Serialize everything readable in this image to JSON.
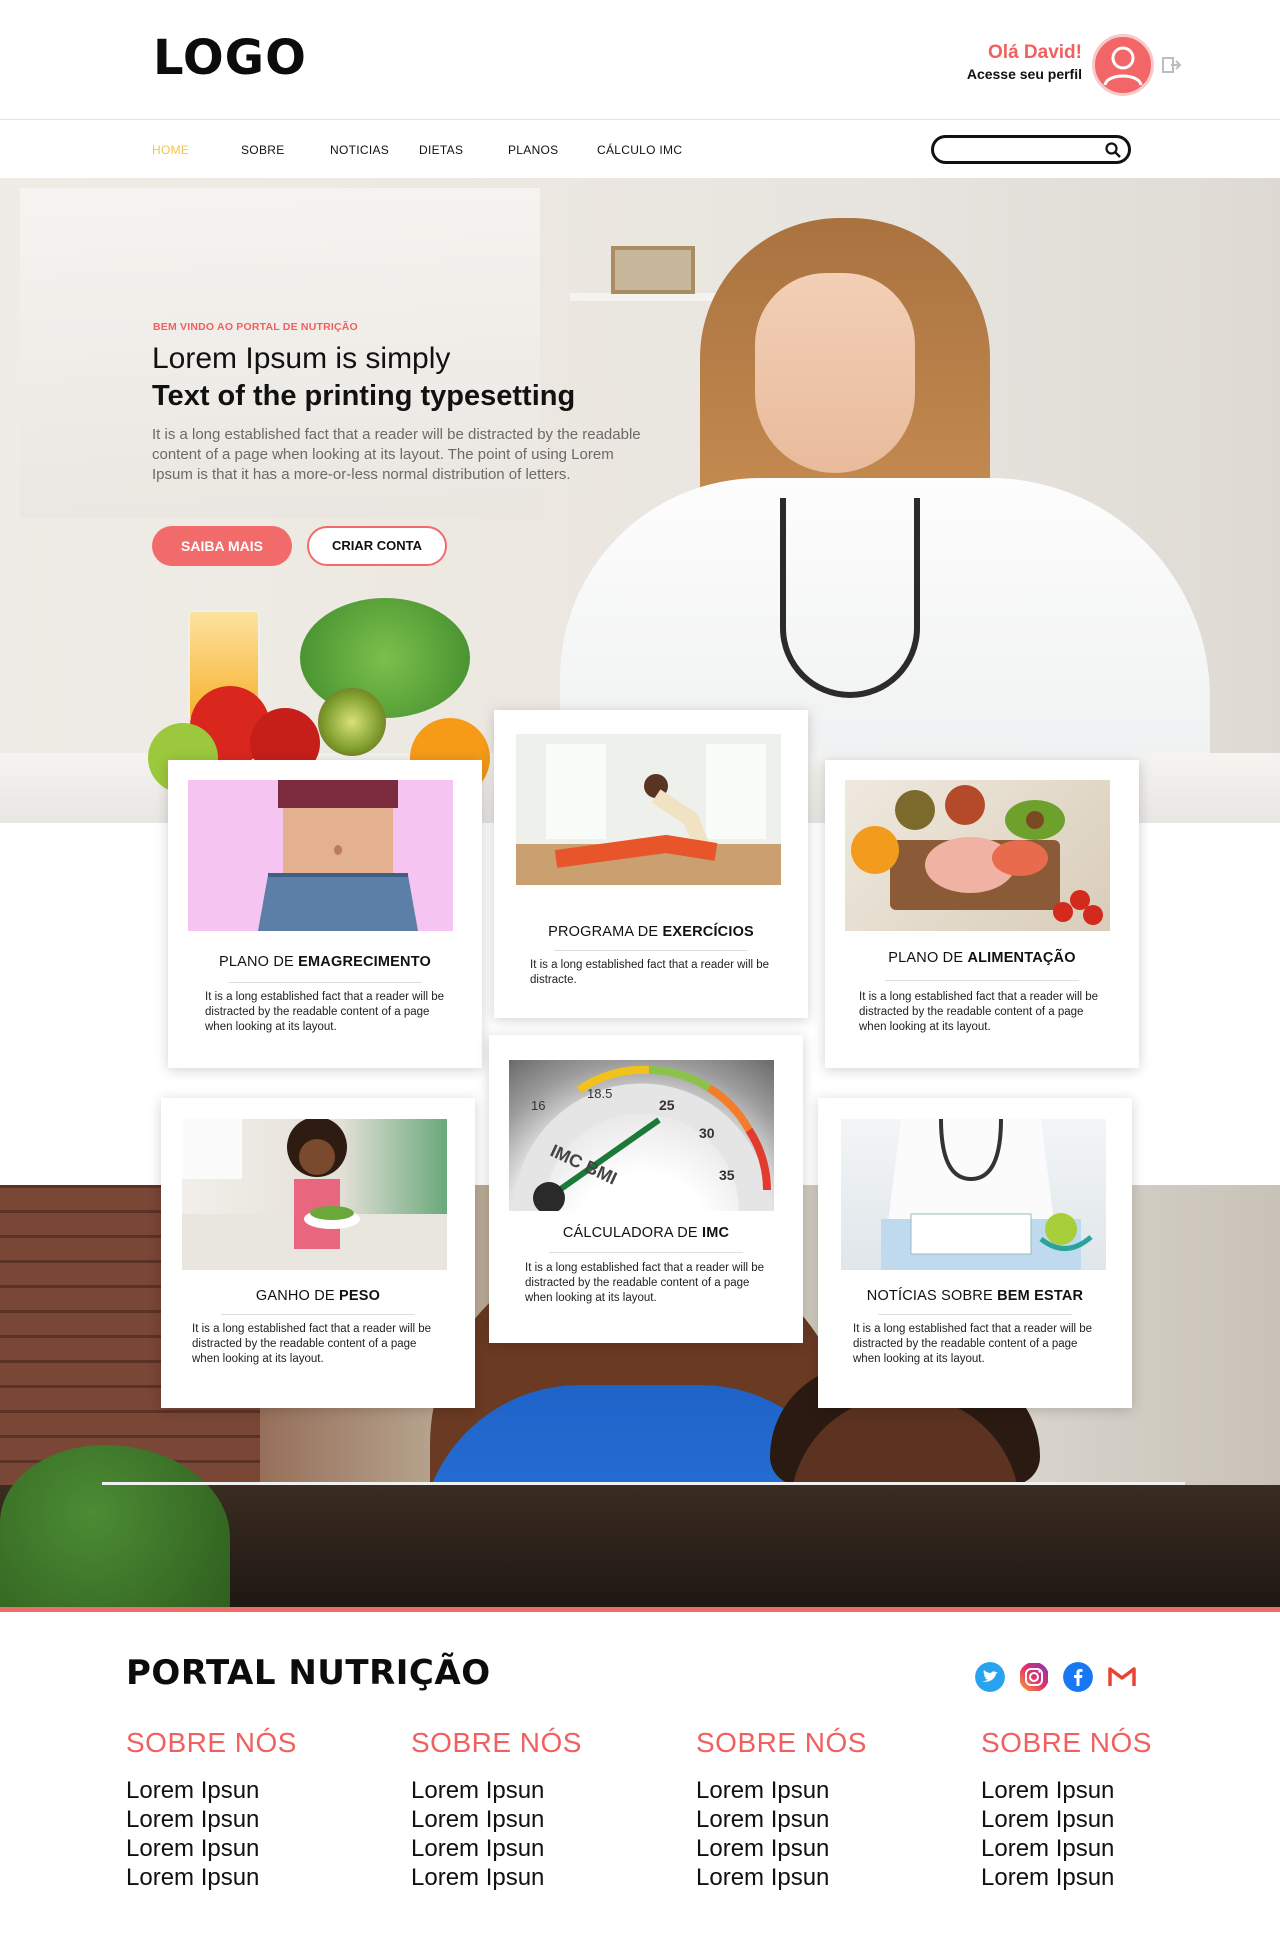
{
  "header": {
    "logo": "LOGO",
    "greeting": "Olá David!",
    "profile_link": "Acesse seu perfil"
  },
  "nav": {
    "items": [
      "HOME",
      "SOBRE",
      "NOTICIAS",
      "DIETAS",
      "PLANOS",
      "CÁLCULO IMC"
    ],
    "active": "HOME",
    "search_placeholder": ""
  },
  "hero": {
    "kicker": "BEM VINDO AO PORTAL DE NUTRIÇÃO",
    "title_light": "Lorem Ipsum is simply",
    "title_bold": "Text of the printing typesetting",
    "text": "It is a long established fact that a reader will be distracted by the readable content of a page when looking at its layout. The point of using Lorem Ipsum is that it has a more-or-less normal distribution of letters.",
    "primary_button": "SAIBA MAIS",
    "secondary_button": "CRIAR CONTA"
  },
  "cards": [
    {
      "title_prefix": "PLANO DE",
      "title_bold": "EMAGRECIMENTO",
      "text": "It is a long established fact that a reader will be distracted by the readable content of a page when looking at its layout."
    },
    {
      "title_prefix": "PROGRAMA DE",
      "title_bold": "EXERCÍCIOS",
      "text": "It is a long established fact that a reader will be distracte."
    },
    {
      "title_prefix": "PLANO DE",
      "title_bold": "ALIMENTAÇÃO",
      "text": "It is a long established fact that a reader will be distracted by the readable content of a page when looking at its layout."
    },
    {
      "title_prefix": "GANHO DE",
      "title_bold": "PESO",
      "text": "It is a long established fact that a reader will be distracted by the readable content of a page when looking at its layout."
    },
    {
      "title_prefix": "CÁLCULADORA DE",
      "title_bold": "IMC",
      "text": "It is a long established fact that a reader will be distracted by the readable content of a page when looking at its layout."
    },
    {
      "title_prefix": "NOTÍCIAS SOBRE",
      "title_bold": "BEM ESTAR",
      "text": "It is a long established fact that a reader will be distracted by the readable content of a page when looking at its layout."
    }
  ],
  "gauge": {
    "ticks": [
      "16",
      "18.5",
      "25",
      "30",
      "35"
    ],
    "label": "IMC BMI"
  },
  "footer": {
    "title": "PORTAL NUTRIÇÃO",
    "social": [
      "twitter-icon",
      "instagram-icon",
      "facebook-icon",
      "gmail-icon"
    ],
    "columns": [
      {
        "heading": "SOBRE NÓS",
        "items": [
          "Lorem Ipsun",
          "Lorem Ipsun",
          "Lorem Ipsun",
          "Lorem Ipsun"
        ]
      },
      {
        "heading": "SOBRE NÓS",
        "items": [
          "Lorem Ipsun",
          "Lorem Ipsun",
          "Lorem Ipsun",
          "Lorem Ipsun"
        ]
      },
      {
        "heading": "SOBRE NÓS",
        "items": [
          "Lorem Ipsun",
          "Lorem Ipsun",
          "Lorem Ipsun",
          "Lorem Ipsun"
        ]
      },
      {
        "heading": "SOBRE NÓS",
        "items": [
          "Lorem Ipsun",
          "Lorem Ipsun",
          "Lorem Ipsun",
          "Lorem Ipsun"
        ]
      }
    ]
  },
  "colors": {
    "accent": "#f26b6b",
    "nav_active": "#f4c542",
    "text": "#111111"
  }
}
